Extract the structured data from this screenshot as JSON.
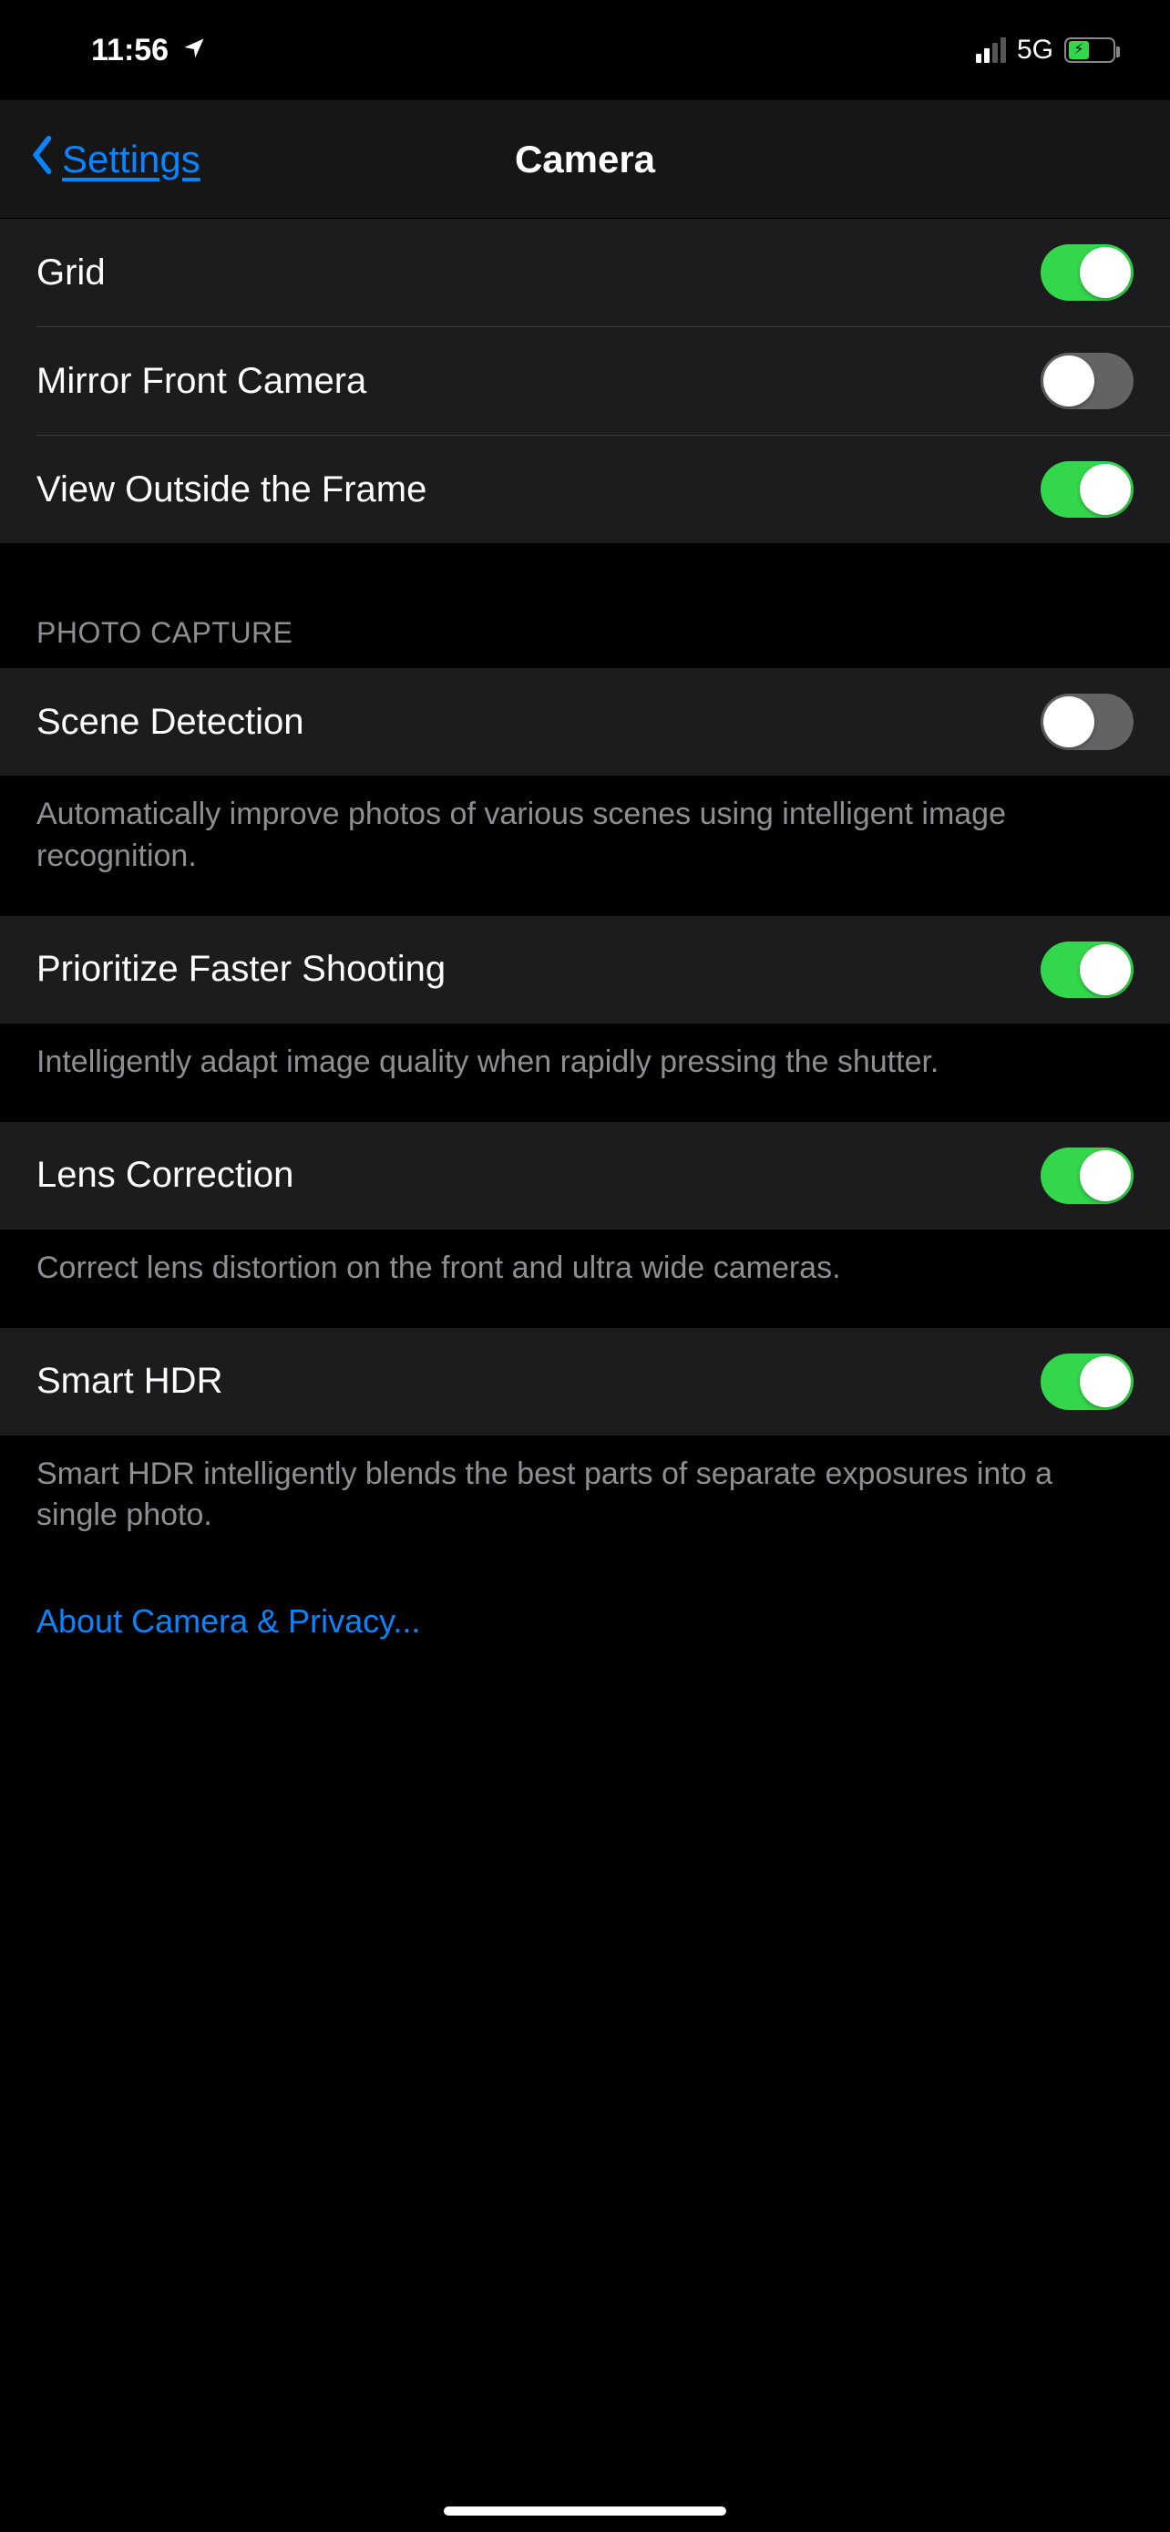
{
  "status": {
    "time": "11:56",
    "network": "5G"
  },
  "nav": {
    "back": "Settings",
    "title": "Camera"
  },
  "composition": {
    "grid": "Grid",
    "mirror": "Mirror Front Camera",
    "viewOutside": "View Outside the Frame"
  },
  "photoCapture": {
    "header": "PHOTO CAPTURE",
    "sceneDetection": "Scene Detection",
    "sceneDetectionFooter": "Automatically improve photos of various scenes using intelligent image recognition.",
    "prioritizeFaster": "Prioritize Faster Shooting",
    "prioritizeFasterFooter": "Intelligently adapt image quality when rapidly pressing the shutter.",
    "lensCorrection": "Lens Correction",
    "lensCorrectionFooter": "Correct lens distortion on the front and ultra wide cameras.",
    "smartHDR": "Smart HDR",
    "smartHDRFooter": "Smart HDR intelligently blends the best parts of separate exposures into a single photo."
  },
  "link": "About Camera & Privacy...",
  "toggles": {
    "grid": true,
    "mirror": false,
    "viewOutside": true,
    "sceneDetection": false,
    "prioritizeFaster": true,
    "lensCorrection": true,
    "smartHDR": true
  }
}
